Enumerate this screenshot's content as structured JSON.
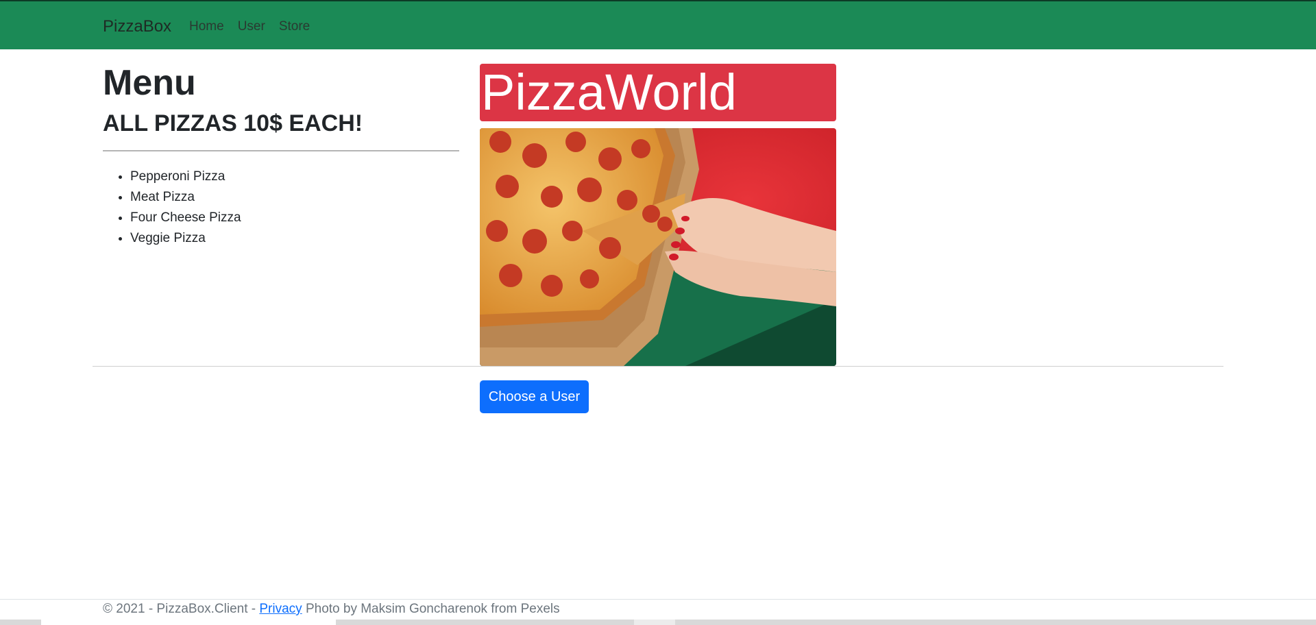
{
  "navbar": {
    "brand": "PizzaBox",
    "links": [
      "Home",
      "User",
      "Store"
    ],
    "background": "#1b8a56"
  },
  "menu": {
    "title": "Menu",
    "subtitle": "ALL PIZZAS 10$ EACH!",
    "items": [
      "Pepperoni Pizza",
      "Meat Pizza",
      "Four Cheese Pizza",
      "Veggie Pizza"
    ]
  },
  "banner": {
    "text": "PizzaWorld",
    "color": "#dc3545"
  },
  "photo": {
    "description_icon": "pizza-image"
  },
  "actions": {
    "choose_user_label": "Choose a User",
    "button_color": "#0d6efd"
  },
  "footer": {
    "prefix": "© 2021 - PizzaBox.Client - ",
    "privacy_link": "Privacy",
    "suffix": " Photo by Maksim Goncharenok from Pexels"
  }
}
